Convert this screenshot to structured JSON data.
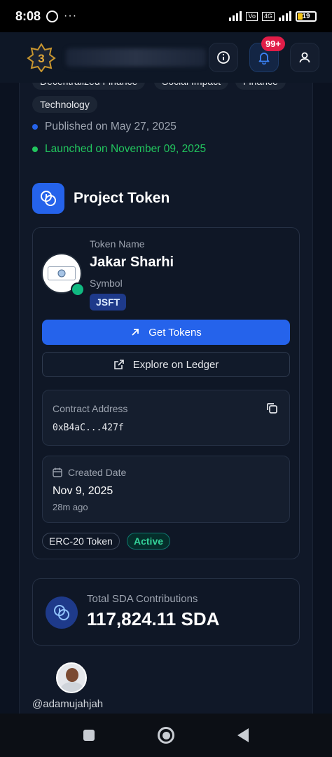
{
  "status_bar": {
    "time": "8:08",
    "more": "···",
    "network": "4G",
    "battery": "19"
  },
  "header": {
    "notification_count": "99+"
  },
  "tags": [
    "Decentralized Finance",
    "Social Impact",
    "Finance",
    "Technology"
  ],
  "timeline": {
    "published": "Published on May 27, 2025",
    "launched": "Launched on November 09, 2025"
  },
  "section": {
    "title": "Project Token"
  },
  "token": {
    "name_label": "Token Name",
    "name": "Jakar Sharhi",
    "symbol_label": "Symbol",
    "symbol": "JSFT",
    "get_tokens": "Get Tokens",
    "explore": "Explore on Ledger",
    "contract_label": "Contract Address",
    "contract": "0xB4aC...427f",
    "created_label": "Created Date",
    "created_date": "Nov 9, 2025",
    "created_ago": "28m ago",
    "standard": "ERC-20 Token",
    "status": "Active"
  },
  "contributions": {
    "label": "Total SDA Contributions",
    "value": "117,824.11 SDA"
  },
  "user": {
    "handle": "@adamujahjah"
  },
  "colors": {
    "accent": "#2563eb",
    "success": "#10b981",
    "badge": "#e11d48",
    "background": "#0b1220"
  }
}
